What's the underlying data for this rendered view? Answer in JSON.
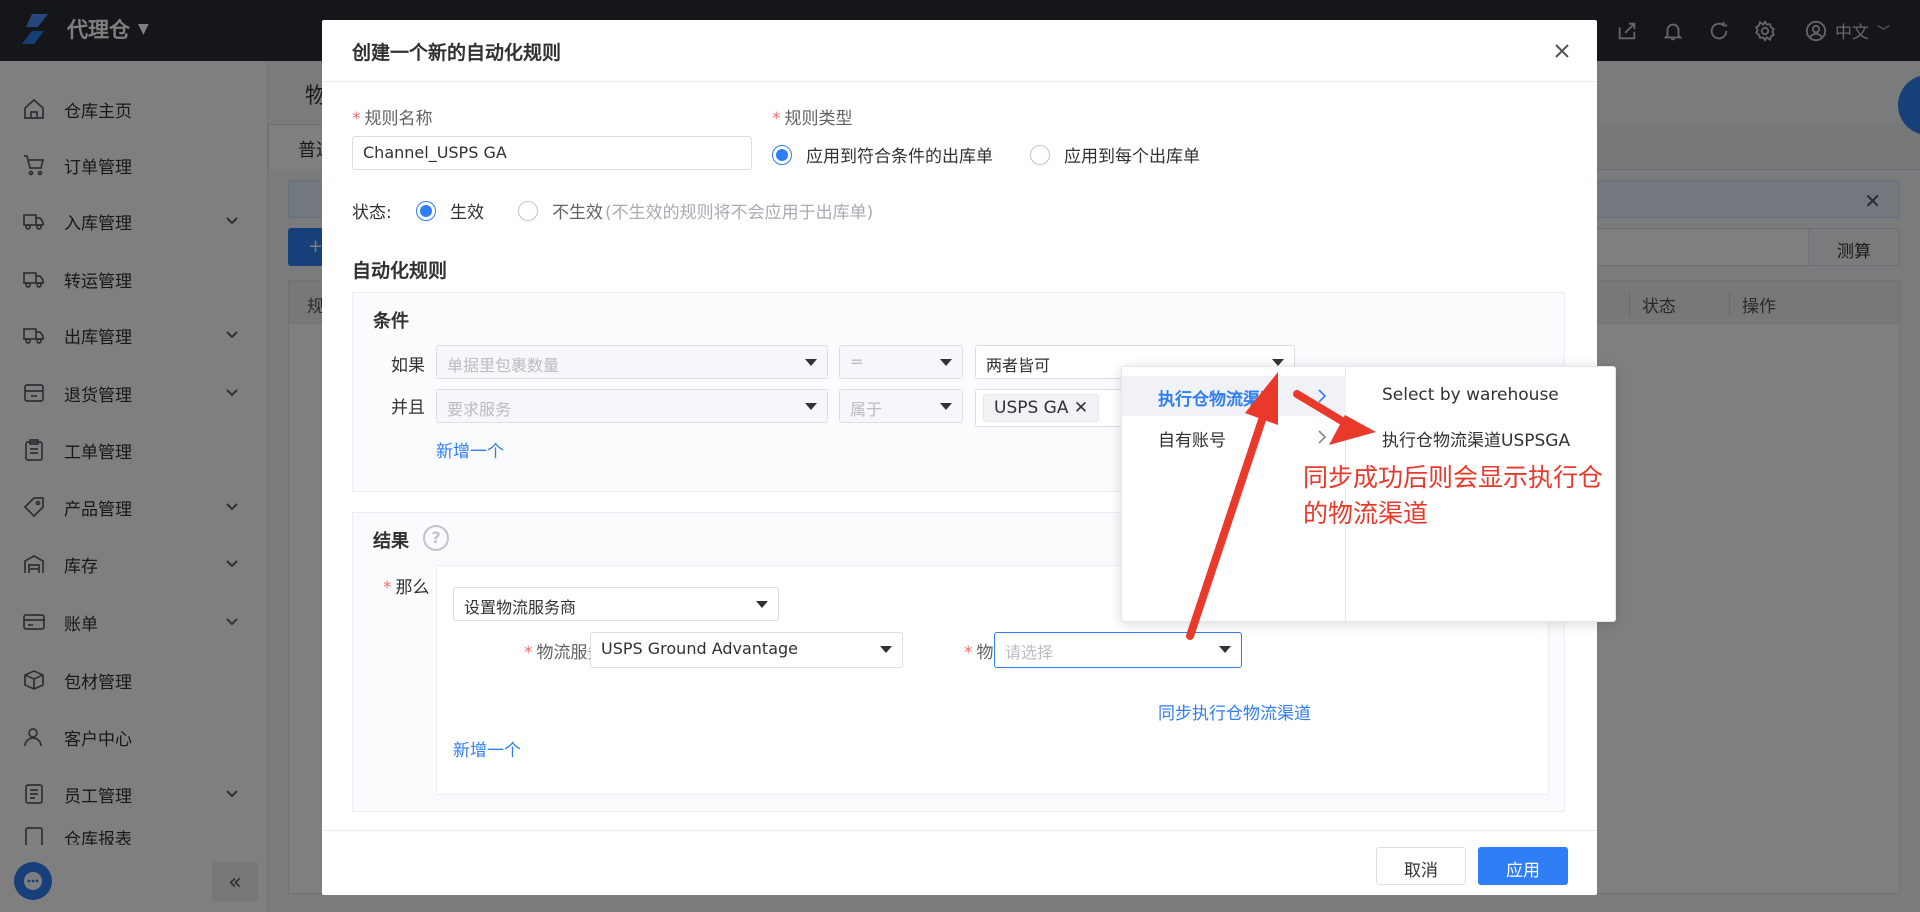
{
  "app": {
    "brand_name": "代理仓",
    "lang": "中文",
    "top_icons": [
      "share-icon",
      "bell-icon",
      "refresh-icon",
      "gear-icon",
      "user-icon"
    ]
  },
  "sidebar": {
    "items": [
      {
        "label": "仓库主页",
        "icon": "home-icon",
        "expandable": false
      },
      {
        "label": "订单管理",
        "icon": "cart-icon",
        "expandable": false
      },
      {
        "label": "入库管理",
        "icon": "truck-in-icon",
        "expandable": true
      },
      {
        "label": "转运管理",
        "icon": "transfer-icon",
        "expandable": false
      },
      {
        "label": "出库管理",
        "icon": "truck-out-icon",
        "expandable": true
      },
      {
        "label": "退货管理",
        "icon": "return-icon",
        "expandable": true
      },
      {
        "label": "工单管理",
        "icon": "clipboard-icon",
        "expandable": false
      },
      {
        "label": "产品管理",
        "icon": "tag-icon",
        "expandable": true
      },
      {
        "label": "库存",
        "icon": "stock-icon",
        "expandable": true
      },
      {
        "label": "账单",
        "icon": "card-icon",
        "expandable": true
      },
      {
        "label": "包材管理",
        "icon": "box-icon",
        "expandable": false
      },
      {
        "label": "客户中心",
        "icon": "person-icon",
        "expandable": false
      },
      {
        "label": "员工管理",
        "icon": "staff-icon",
        "expandable": true
      },
      {
        "label": "仓库报表",
        "icon": "report-icon",
        "expandable": true
      }
    ],
    "collapse_glyph": "«"
  },
  "background": {
    "page_title": "物",
    "tab_label": "普通",
    "add_button": "+",
    "measure_button": "测算",
    "table_headers": [
      "规",
      "状态",
      "操作"
    ]
  },
  "modal": {
    "title": "创建一个新的自动化规则",
    "rule_name_label": "规则名称",
    "rule_name_value": "Channel_USPS GA",
    "rule_type_label": "规则类型",
    "rule_type_options": [
      "应用到符合条件的出库单",
      "应用到每个出库单"
    ],
    "rule_type_selected": 0,
    "status_label": "状态:",
    "status_on": "生效",
    "status_off": "不生效",
    "status_off_note": "(不生效的规则将不会应用于出库单)",
    "automation_title": "自动化规则",
    "conditions": {
      "title": "条件",
      "rows": [
        {
          "prefix": "如果",
          "field": "单据里包裹数量",
          "operator": "=",
          "value": "两者皆可"
        },
        {
          "prefix": "并且",
          "field": "要求服务",
          "operator": "属于",
          "value_tag": "USPS GA"
        }
      ],
      "add_link": "新增一个"
    },
    "results": {
      "title": "结果",
      "help_glyph": "?",
      "then_label": "那么",
      "action": "设置物流服务商",
      "service_label": "物流服务",
      "service_value": "USPS Ground Advantage",
      "account_label": "物流账号/渠道",
      "account_placeholder": "请选择",
      "sync_link": "同步执行仓物流渠道",
      "add_link": "新增一个"
    },
    "cancel": "取消",
    "apply": "应用"
  },
  "cascader": {
    "level1": [
      {
        "label": "执行仓物流渠道",
        "active": true
      },
      {
        "label": "自有账号",
        "active": false
      }
    ],
    "level2": [
      "Select by warehouse",
      "执行仓物流渠道USPSGA"
    ]
  },
  "annotation": {
    "lines": [
      "同步成功后则会显示执行仓",
      "的物流渠道"
    ],
    "color": "#e8392a"
  },
  "colors": {
    "primary": "#2f7ef5",
    "topbar": "#2a2d34",
    "required": "#f56c6c"
  }
}
